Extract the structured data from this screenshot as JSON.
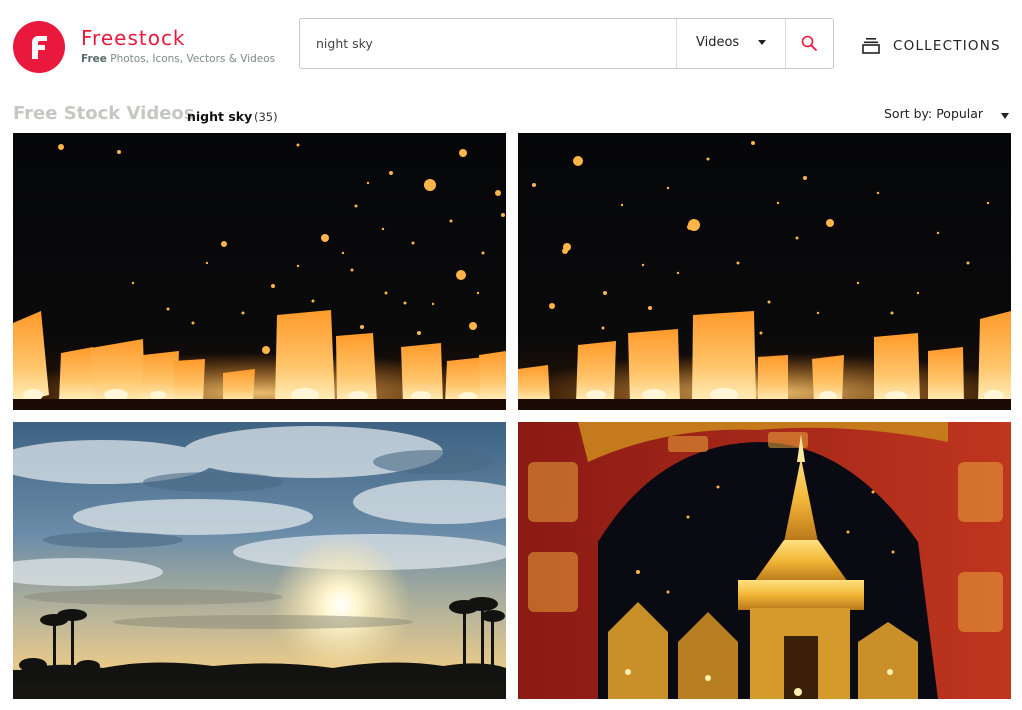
{
  "brand": {
    "name": "Freestock",
    "tagline_bold": "Free",
    "tagline_rest": " Photos, Icons, Vectors & Videos",
    "color": "#e9193d"
  },
  "search": {
    "value": "night sky",
    "type_selected": "Videos",
    "button_icon": "search-icon"
  },
  "nav": {
    "collections_label": "COLLECTIONS",
    "collections_icon": "collections-stack-icon"
  },
  "results": {
    "section_title": "Free Stock Videos",
    "query": "night sky",
    "count": "(35)",
    "sort_label": "Sort by: Popular"
  },
  "grid": {
    "items": [
      {
        "subject": "floating sky lanterns at night"
      },
      {
        "subject": "floating sky lanterns at night"
      },
      {
        "subject": "sunset sky with clouds and palm trees"
      },
      {
        "subject": "golden temple pagoda at night with lanterns"
      }
    ]
  },
  "colors": {
    "accent": "#e9193d",
    "section_title": "#c4c8c4",
    "border": "#c9c9c9"
  }
}
